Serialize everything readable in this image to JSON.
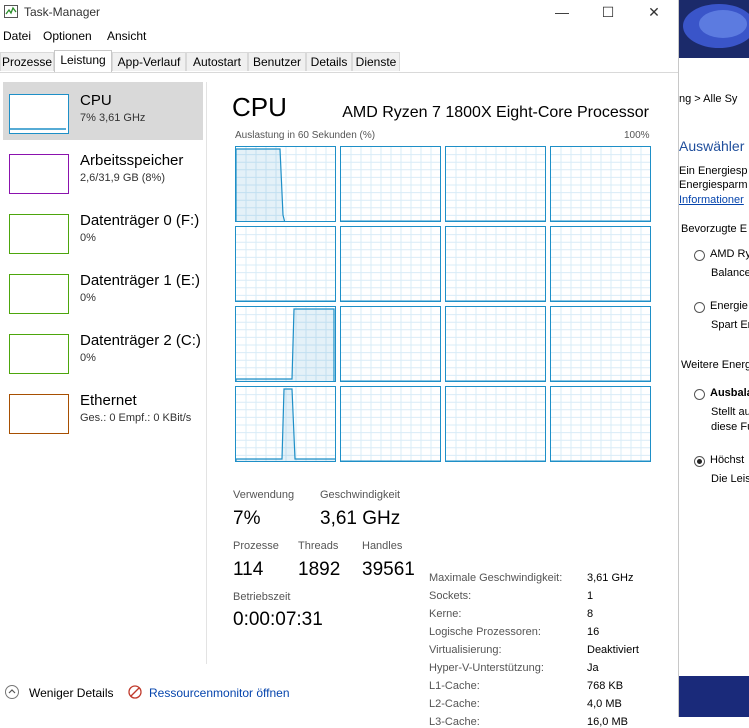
{
  "window": {
    "title": "Task-Manager",
    "minimize_glyph": "—",
    "maximize_glyph": "☐",
    "close_glyph": "✕"
  },
  "menu": [
    "Datei",
    "Optionen",
    "Ansicht"
  ],
  "tabs": [
    "Prozesse",
    "Leistung",
    "App-Verlauf",
    "Autostart",
    "Benutzer",
    "Details",
    "Dienste"
  ],
  "active_tab": "Leistung",
  "sidebar": [
    {
      "name": "CPU",
      "sub": "7% 3,61 GHz",
      "color": "#1e8fc7",
      "selected": true
    },
    {
      "name": "Arbeitsspeicher",
      "sub": "2,6/31,9 GB (8%)",
      "color": "#8b12ae",
      "selected": false
    },
    {
      "name": "Datenträger 0 (F:)",
      "sub": "0%",
      "color": "#4da60c",
      "selected": false
    },
    {
      "name": "Datenträger 1 (E:)",
      "sub": "0%",
      "color": "#4da60c",
      "selected": false
    },
    {
      "name": "Datenträger 2 (C:)",
      "sub": "0%",
      "color": "#4da60c",
      "selected": false
    },
    {
      "name": "Ethernet",
      "sub": "Ges.: 0 Empf.: 0 KBit/s",
      "color": "#a74f01",
      "selected": false
    }
  ],
  "main": {
    "title": "CPU",
    "processor": "AMD Ryzen 7 1800X Eight-Core Processor",
    "graph_label": "Auslastung in 60 Sekunden (%)",
    "graph_max": "100%",
    "graph_color": "#1e8fc7",
    "core_count": 16
  },
  "stats": {
    "usage_label": "Verwendung",
    "usage": "7%",
    "speed_label": "Geschwindigkeit",
    "speed": "3,61 GHz",
    "proc_label": "Prozesse",
    "proc": "114",
    "threads_label": "Threads",
    "threads": "1892",
    "handles_label": "Handles",
    "handles": "39561",
    "uptime_label": "Betriebszeit",
    "uptime": "0:00:07:31"
  },
  "info": [
    {
      "label": "Maximale Geschwindigkeit:",
      "value": "3,61 GHz"
    },
    {
      "label": "Sockets:",
      "value": "1"
    },
    {
      "label": "Kerne:",
      "value": "8"
    },
    {
      "label": "Logische Prozessoren:",
      "value": "16"
    },
    {
      "label": "Virtualisierung:",
      "value": "Deaktiviert"
    },
    {
      "label": "Hyper-V-Unterstützung:",
      "value": "Ja"
    },
    {
      "label": "L1-Cache:",
      "value": "768 KB"
    },
    {
      "label": "L2-Cache:",
      "value": "4,0 MB"
    },
    {
      "label": "L3-Cache:",
      "value": "16,0 MB"
    }
  ],
  "bottom": {
    "less": "Weniger Details",
    "resmon": "Ressourcenmonitor öffnen"
  },
  "right_window": {
    "breadcrumb": "ng  >  Alle Sy",
    "heading": "Auswähler",
    "line1": "Ein Energiesp",
    "line2": "Energiesparm",
    "link": "Informationer",
    "pref_label": "Bevorzugte E",
    "opt1a": "AMD Ry",
    "opt1b": "Balance",
    "opt2a": "Energie",
    "opt2b": "Spart Er",
    "more_label": "Weitere Energ",
    "opt3a": "Ausbala",
    "opt3b": "Stellt au",
    "opt3c": "diese Fu",
    "opt4a": "Höchst",
    "opt4b": "Die Leis"
  }
}
